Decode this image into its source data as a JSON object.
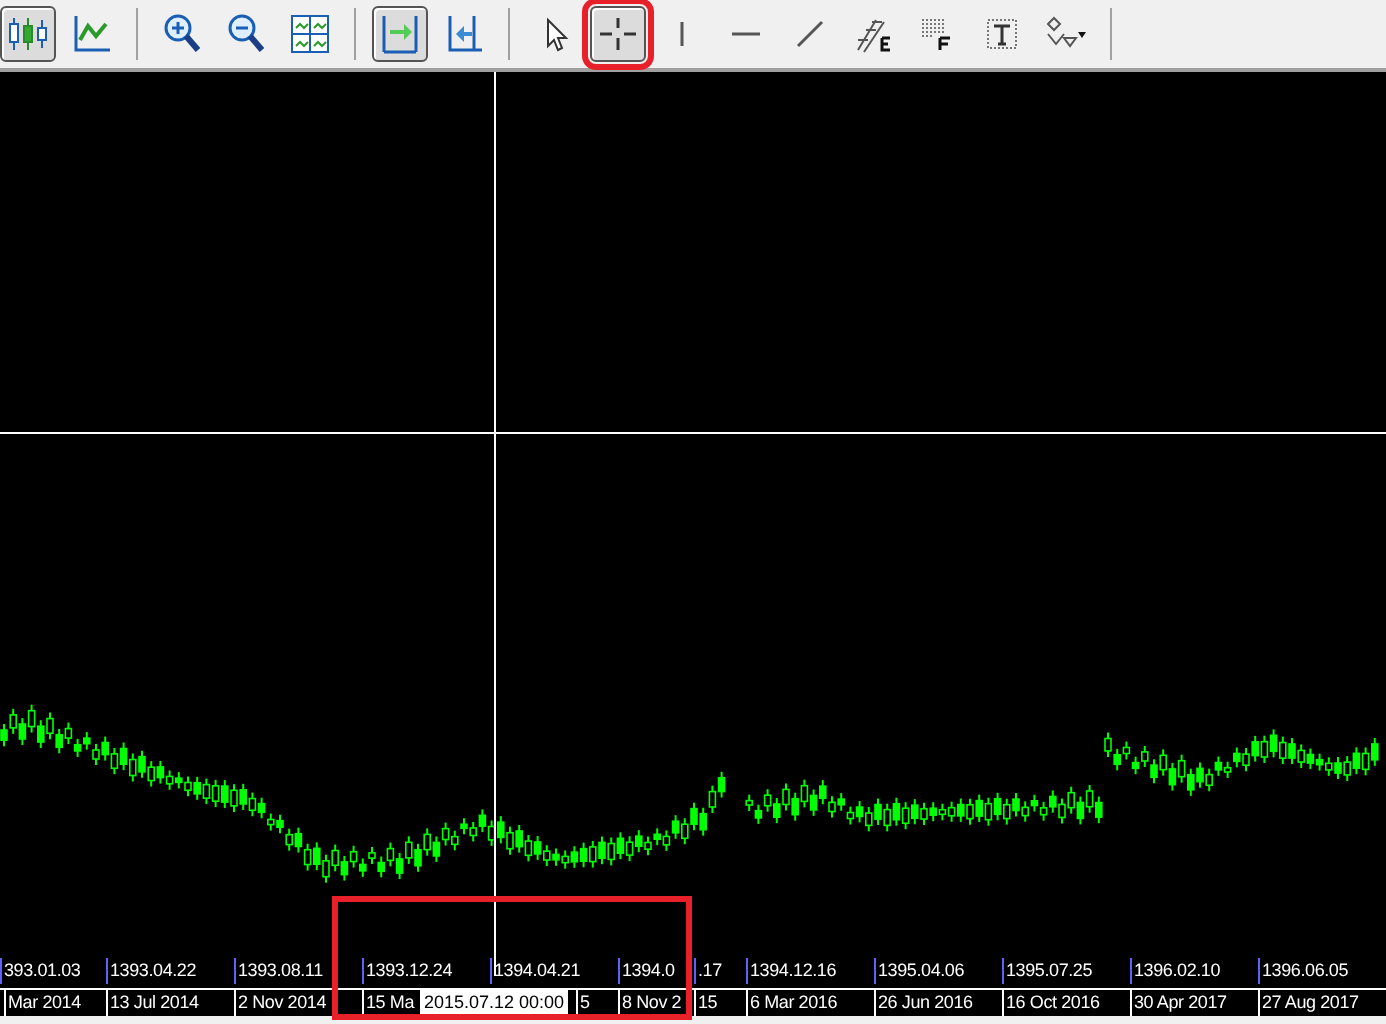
{
  "toolbar": {
    "groups": [
      [
        {
          "kind": "candles",
          "selected": true,
          "highlighted": false
        },
        {
          "kind": "line-chart",
          "selected": false,
          "highlighted": false
        }
      ],
      [
        {
          "kind": "zoom-in",
          "selected": false,
          "highlighted": false
        },
        {
          "kind": "zoom-out",
          "selected": false,
          "highlighted": false
        },
        {
          "kind": "tile",
          "selected": false,
          "highlighted": false
        }
      ],
      [
        {
          "kind": "autoscroll",
          "selected": true,
          "highlighted": false
        },
        {
          "kind": "shift",
          "selected": false,
          "highlighted": false
        }
      ],
      [
        {
          "kind": "cursor",
          "selected": false,
          "highlighted": false
        },
        {
          "kind": "crosshair",
          "selected": true,
          "highlighted": true
        },
        {
          "kind": "vline",
          "selected": false,
          "highlighted": false
        },
        {
          "kind": "hline",
          "selected": false,
          "highlighted": false
        },
        {
          "kind": "trendline",
          "selected": false,
          "highlighted": false
        },
        {
          "kind": "fibo",
          "selected": false,
          "highlighted": false
        },
        {
          "kind": "fibo-grid",
          "selected": false,
          "highlighted": false
        },
        {
          "kind": "text",
          "selected": false,
          "highlighted": false
        },
        {
          "kind": "arrows",
          "selected": false,
          "highlighted": false
        }
      ]
    ]
  },
  "axis": {
    "highlighted": true,
    "top_labels": [
      {
        "text": "393.01.03"
      },
      {
        "text": "1393.04.22"
      },
      {
        "text": "1393.08.11"
      },
      {
        "text": "1393.12.24"
      },
      {
        "text": "1394.04.21"
      },
      {
        "text": "1394.0",
        "tail": ".17"
      },
      {
        "text": "1394.12.16"
      },
      {
        "text": "1395.04.06"
      },
      {
        "text": "1395.07.25"
      },
      {
        "text": "1396.02.10"
      },
      {
        "text": "1396.06.05"
      }
    ],
    "bottom_labels": [
      {
        "text": "Mar 2014"
      },
      {
        "text": "13 Jul 2014"
      },
      {
        "text": "2 Nov 2014"
      },
      {
        "text": "15 Ma",
        "tail": "5"
      },
      {
        "text": "8 Nov 2",
        "tail": "15"
      },
      {
        "text": "6 Mar 2016"
      },
      {
        "text": "26 Jun 2016"
      },
      {
        "text": "16 Oct 2016"
      },
      {
        "text": "30 Apr 2017"
      },
      {
        "text": "27 Aug 2017"
      }
    ]
  },
  "crosshair": {
    "time_label": "2015.07.12 00:00"
  }
}
